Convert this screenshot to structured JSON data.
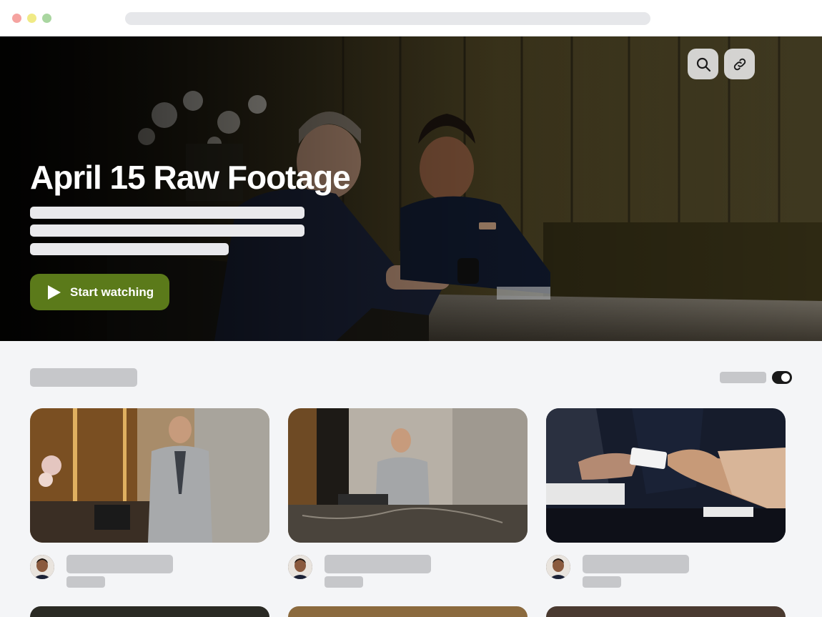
{
  "hero": {
    "title": "April 15 Raw Footage",
    "cta_label": "Start watching",
    "accent_color": "#5b7a1a",
    "icons": [
      "search-icon",
      "link-icon"
    ]
  },
  "section": {
    "toggle_on": true
  },
  "cards": [
    {
      "thumbnail": "receptionist-on-phone"
    },
    {
      "thumbnail": "receptionist-at-marble-desk"
    },
    {
      "thumbnail": "hands-exchanging-key-card"
    }
  ]
}
